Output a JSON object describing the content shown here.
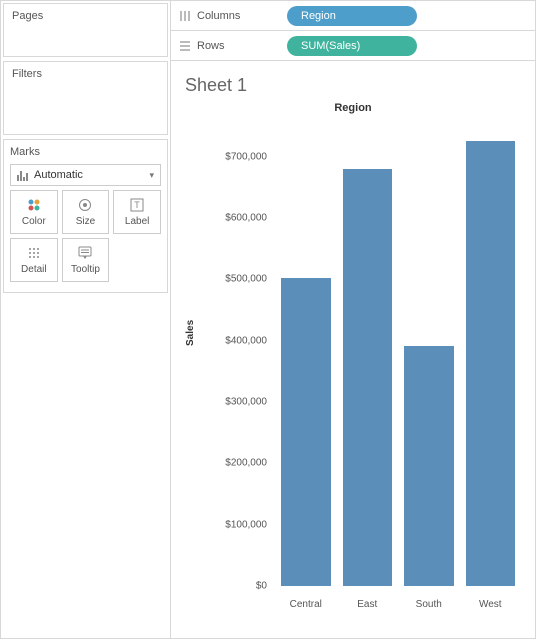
{
  "left_panel": {
    "pages": {
      "title": "Pages"
    },
    "filters": {
      "title": "Filters"
    },
    "marks": {
      "title": "Marks",
      "selector": {
        "icon": "bar-chart-icon",
        "label": "Automatic"
      },
      "buttons": [
        {
          "name": "color",
          "label": "Color"
        },
        {
          "name": "size",
          "label": "Size"
        },
        {
          "name": "label",
          "label": "Label"
        },
        {
          "name": "detail",
          "label": "Detail"
        },
        {
          "name": "tooltip",
          "label": "Tooltip"
        }
      ]
    }
  },
  "shelves": {
    "columns": {
      "label": "Columns",
      "pill": {
        "text": "Region",
        "color": "blue"
      }
    },
    "rows": {
      "label": "Rows",
      "pill": {
        "text": "SUM(Sales)",
        "color": "green"
      }
    }
  },
  "sheet": {
    "title": "Sheet 1",
    "chart_title": "Region",
    "yaxis_label": "Sales",
    "yticks": [
      "$0",
      "$100,000",
      "$200,000",
      "$300,000",
      "$400,000",
      "$500,000",
      "$600,000",
      "$700,000"
    ]
  },
  "chart_data": {
    "type": "bar",
    "title": "Region",
    "xlabel": "",
    "ylabel": "Sales",
    "categories": [
      "Central",
      "East",
      "South",
      "West"
    ],
    "values": [
      503000,
      680000,
      392000,
      726000
    ],
    "ylim": [
      0,
      750000
    ],
    "grid": false,
    "bar_color": "#5b8fb9"
  }
}
